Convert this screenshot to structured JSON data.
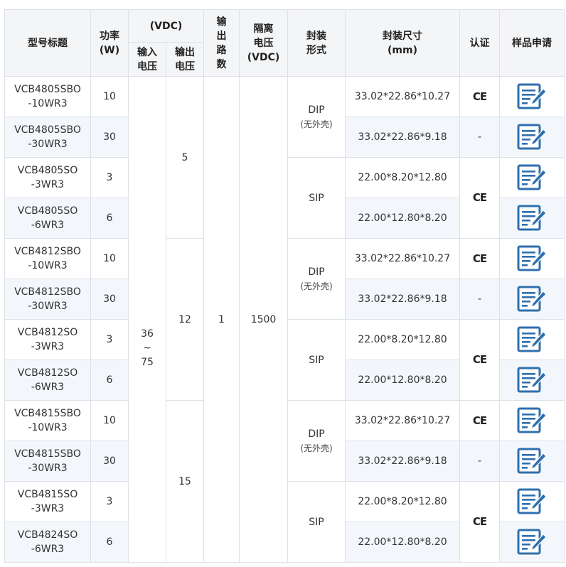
{
  "headers": {
    "model": "型号标题",
    "power": "功率\n(W)",
    "vdc_group": "(VDC)",
    "input_voltage": "输入\n电压",
    "output_voltage": "输出\n电压",
    "outputs": "输\n出\n路\n数",
    "isolation": "隔离\n电压\n(VDC)",
    "package": "封装\n形式",
    "dimensions": "封装尺寸\n(mm)",
    "cert": "认证",
    "sample": "样品申请"
  },
  "groups": {
    "input_voltage": "36\n~\n75",
    "outputs": "1",
    "isolation": "1500",
    "output_voltages": [
      "5",
      "12",
      "15"
    ],
    "package_dip": "DIP",
    "package_dip_sub": "(无外壳)",
    "package_sip": "SIP",
    "cert_ce": "CE",
    "cert_none": "-"
  },
  "rows": [
    {
      "model": "VCB4805SBO\n-10WR3",
      "power": "10",
      "dimensions": "33.02*22.86*10.27"
    },
    {
      "model": "VCB4805SBO\n-30WR3",
      "power": "30",
      "dimensions": "33.02*22.86*9.18"
    },
    {
      "model": "VCB4805SO\n-3WR3",
      "power": "3",
      "dimensions": "22.00*8.20*12.80"
    },
    {
      "model": "VCB4805SO\n-6WR3",
      "power": "6",
      "dimensions": "22.00*12.80*8.20"
    },
    {
      "model": "VCB4812SBO\n-10WR3",
      "power": "10",
      "dimensions": "33.02*22.86*10.27"
    },
    {
      "model": "VCB4812SBO\n-30WR3",
      "power": "30",
      "dimensions": "33.02*22.86*9.18"
    },
    {
      "model": "VCB4812SO\n-3WR3",
      "power": "3",
      "dimensions": "22.00*8.20*12.80"
    },
    {
      "model": "VCB4812SO\n-6WR3",
      "power": "6",
      "dimensions": "22.00*12.80*8.20"
    },
    {
      "model": "VCB4815SBO\n-10WR3",
      "power": "10",
      "dimensions": "33.02*22.86*10.27"
    },
    {
      "model": "VCB4815SBO\n-30WR3",
      "power": "30",
      "dimensions": "33.02*22.86*9.18"
    },
    {
      "model": "VCB4815SO\n-3WR3",
      "power": "3",
      "dimensions": "22.00*8.20*12.80"
    },
    {
      "model": "VCB4824SO\n-6WR3",
      "power": "6",
      "dimensions": "22.00*12.80*8.20"
    }
  ],
  "icons": {
    "sample": "edit-document-icon",
    "color": "#2f6fad"
  }
}
